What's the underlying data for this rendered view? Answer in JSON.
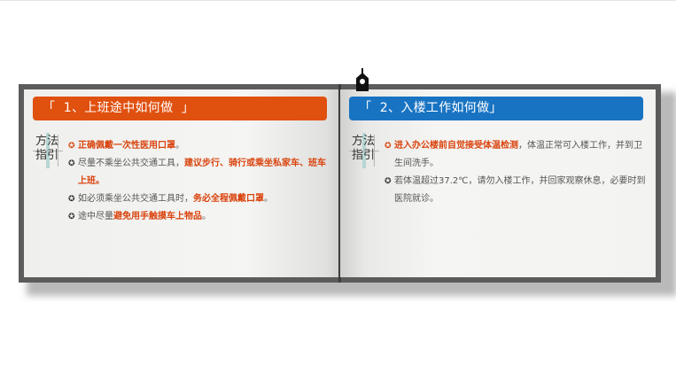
{
  "left": {
    "header": "「  1、上班途中如何做  」",
    "tag_line1": "方法",
    "tag_line2": "指引",
    "items": [
      {
        "p": [
          "",
          "正确佩戴一次性医用口罩",
          "。"
        ],
        "bullet_color": "red"
      },
      {
        "p": [
          "尽量不乘坐公共交通工具，",
          "建议步行、骑行或乘坐私家车、班车上班。",
          ""
        ],
        "bullet_color": "dark"
      },
      {
        "p": [
          "如必须乘坐公共交通工具时，",
          "务必全程佩戴口罩",
          "。"
        ],
        "bullet_color": "dark"
      },
      {
        "p": [
          "途中尽量",
          "避免用手触摸车上物品",
          "。"
        ],
        "bullet_color": "dark"
      }
    ]
  },
  "right": {
    "header": "「  2、入楼工作如何做」",
    "tag_line1": "方法",
    "tag_line2": "指引",
    "items": [
      {
        "p": [
          "",
          "进入办公楼前自觉接受体温检测",
          "，体温正常可入楼工作，并到卫生间洗手。"
        ],
        "bullet_color": "red"
      },
      {
        "p": [
          "若体温超过37.2℃，请勿入楼工作，并回家观察休息，必要时到医院就诊。",
          "",
          ""
        ],
        "bullet_color": "dark"
      }
    ]
  },
  "colors": {
    "orange_header": "#e0500f",
    "blue_header": "#1873c2",
    "highlight": "#d9430d",
    "book_frame": "#5c5c5c"
  },
  "icons": {
    "bullet": "gear-bullet-icon",
    "clip": "bookmark-clip-icon"
  }
}
